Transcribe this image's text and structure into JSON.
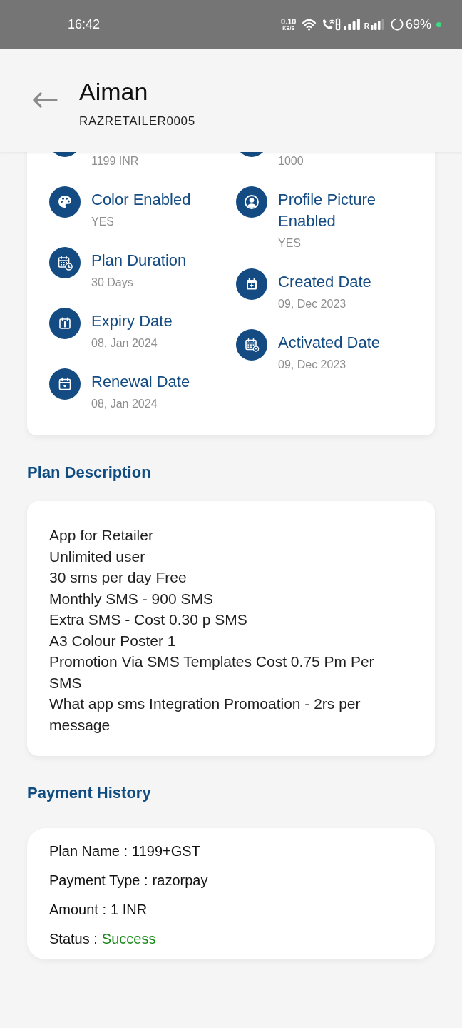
{
  "status_bar": {
    "time": "16:42",
    "network_speed": "0.10",
    "speed_unit": "KB/S",
    "roaming": "R",
    "battery": "69%"
  },
  "header": {
    "title": "Aiman",
    "subtitle": "RAZRETAILER0005"
  },
  "plan_details": {
    "left_column": [
      {
        "value": "1199 INR"
      },
      {
        "label": "Color Enabled",
        "value": "YES"
      },
      {
        "label": "Plan Duration",
        "value": "30 Days"
      },
      {
        "label": "Expiry Date",
        "value": "08, Jan 2024"
      },
      {
        "label": "Renewal Date",
        "value": "08, Jan 2024"
      }
    ],
    "right_column": [
      {
        "value": "1000"
      },
      {
        "label": "Profile Picture Enabled",
        "value": "YES"
      },
      {
        "label": "Created Date",
        "value": "09, Dec 2023"
      },
      {
        "label": "Activated Date",
        "value": "09, Dec 2023"
      }
    ]
  },
  "plan_description": {
    "heading": "Plan Description",
    "lines": [
      "App for Retailer",
      "Unlimited user",
      "30 sms per day Free",
      "Monthly SMS - 900 SMS",
      "Extra SMS - Cost 0.30 p SMS",
      "A3 Colour Poster 1",
      "Promotion Via SMS Templates Cost 0.75 Pm Per SMS",
      "What app sms Integration Promoation - 2rs per message"
    ]
  },
  "payment_history": {
    "heading": "Payment History",
    "rows": [
      {
        "kind": "text",
        "label": "Plan Name :",
        "value": "1199+GST"
      },
      {
        "kind": "text",
        "label": "Payment Type :",
        "value": "razorpay"
      },
      {
        "kind": "text",
        "label": "Amount :",
        "value": "1 INR"
      },
      {
        "kind": "status",
        "label": "Status :",
        "value": "Success"
      }
    ]
  }
}
